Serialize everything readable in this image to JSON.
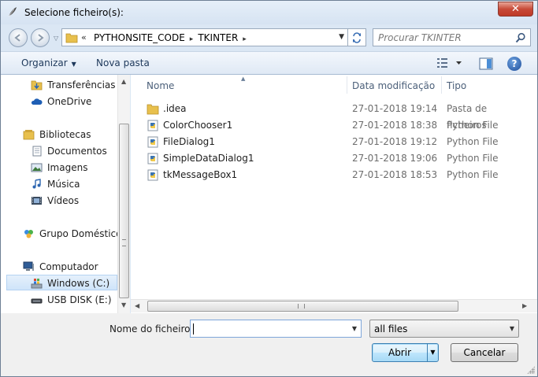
{
  "window": {
    "title": "Selecione ficheiro(s):",
    "close_label": "✕"
  },
  "address": {
    "prefix": "«",
    "crumbs": [
      "PYTHONSITE_CODE",
      "TKINTER"
    ],
    "separator": "▸"
  },
  "search": {
    "placeholder": "Procurar TKINTER"
  },
  "toolbar": {
    "organize_label": "Organizar",
    "new_folder_label": "Nova pasta",
    "help_label": "?"
  },
  "nav": {
    "items": [
      {
        "label": "Transferências",
        "icon": "downloads-folder-icon"
      },
      {
        "label": "OneDrive",
        "icon": "onedrive-cloud-icon"
      },
      {
        "label": "Bibliotecas",
        "icon": "libraries-icon"
      },
      {
        "label": "Documentos",
        "icon": "documents-icon"
      },
      {
        "label": "Imagens",
        "icon": "pictures-icon"
      },
      {
        "label": "Música",
        "icon": "music-icon"
      },
      {
        "label": "Vídeos",
        "icon": "videos-icon"
      },
      {
        "label": "Grupo Doméstico",
        "icon": "homegroup-icon"
      },
      {
        "label": "Computador",
        "icon": "computer-icon"
      },
      {
        "label": "Windows (C:)",
        "icon": "windows-drive-icon",
        "selected": true
      },
      {
        "label": "USB DISK (E:)",
        "icon": "usb-drive-icon"
      }
    ]
  },
  "columns": {
    "name": "Nome",
    "date": "Data modificação",
    "type": "Tipo"
  },
  "files": [
    {
      "name": ".idea",
      "date": "27-01-2018 19:14",
      "type": "Pasta de ficheiros",
      "icon": "folder-icon"
    },
    {
      "name": "ColorChooser1",
      "date": "27-01-2018 18:38",
      "type": "Python File",
      "icon": "python-file-icon"
    },
    {
      "name": "FileDialog1",
      "date": "27-01-2018 19:12",
      "type": "Python File",
      "icon": "python-file-icon"
    },
    {
      "name": "SimpleDataDialog1",
      "date": "27-01-2018 19:06",
      "type": "Python File",
      "icon": "python-file-icon"
    },
    {
      "name": "tkMessageBox1",
      "date": "27-01-2018 18:53",
      "type": "Python File",
      "icon": "python-file-icon"
    }
  ],
  "footer": {
    "filename_label": "Nome do ficheiro:",
    "filename_value": "",
    "filter_value": "all files",
    "open_label": "Abrir",
    "cancel_label": "Cancelar"
  },
  "colors": {
    "accent": "#3c7fb1",
    "close": "#c74a38",
    "window_frame": "#dbe7f4"
  }
}
